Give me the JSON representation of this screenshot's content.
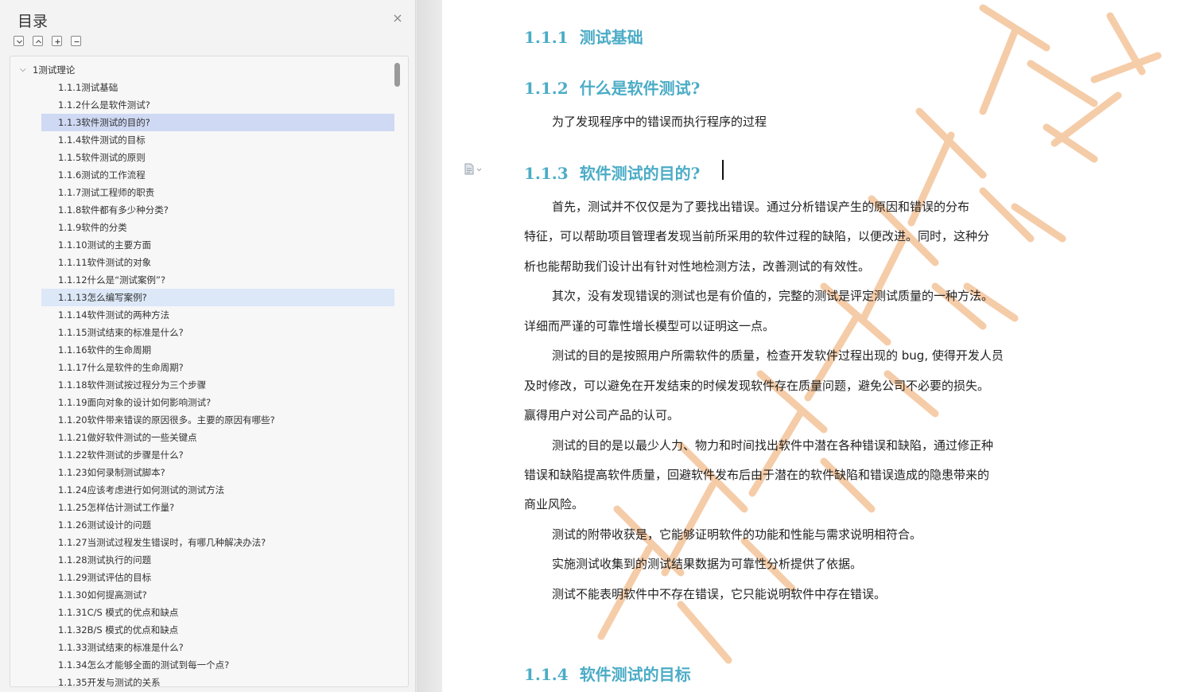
{
  "toc": {
    "title": "目录",
    "close_label": "×",
    "root": {
      "label": "1测试理论"
    },
    "items": [
      "1.1.1测试基础",
      "1.1.2什么是软件测试?",
      "1.1.3软件测试的目的?",
      "1.1.4软件测试的目标",
      "1.1.5软件测试的原则",
      "1.1.6测试的工作流程",
      "1.1.7测试工程师的职责",
      "1.1.8软件都有多少种分类?",
      "1.1.9软件的分类",
      "1.1.10测试的主要方面",
      "1.1.11软件测试的对象",
      "1.1.12什么是“测试案例”?",
      "1.1.13怎么编写案例?",
      "1.1.14软件测试的两种方法",
      "1.1.15测试结束的标准是什么?",
      "1.1.16软件的生命周期",
      "1.1.17什么是软件的生命周期?",
      "1.1.18软件测试按过程分为三个步骤",
      "1.1.19面向对象的设计如何影响测试?",
      "1.1.20软件带来错误的原因很多。主要的原因有哪些?",
      "1.1.21做好软件测试的一些关键点",
      "1.1.22软件测试的步骤是什么?",
      "1.1.23如何录制测试脚本?",
      "1.1.24应该考虑进行如何测试的测试方法",
      "1.1.25怎样估计测试工作量?",
      "1.1.26测试设计的问题",
      "1.1.27当测试过程发生错误时，有哪几种解决办法?",
      "1.1.28测试执行的问题",
      "1.1.29测试评估的目标",
      "1.1.30如何提高测试?",
      "1.1.31C/S 模式的优点和缺点",
      "1.1.32B/S 模式的优点和缺点",
      "1.1.33测试结束的标准是什么?",
      "1.1.34怎么才能够全面的测试到每一个点?",
      "1.1.35开发与测试的关系"
    ],
    "selected_index": 2,
    "hover_index": 12
  },
  "document": {
    "headings": [
      {
        "num": "1.1.1",
        "text": "测试基础"
      },
      {
        "num": "1.1.2",
        "text": "什么是软件测试?"
      },
      {
        "num": "1.1.3",
        "text": "软件测试的目的?"
      },
      {
        "num": "1.1.4",
        "text": "软件测试的目标"
      }
    ],
    "lines": [
      "为了发现程序中的错误而执行程序的过程",
      "首先，测试并不仅仅是为了要找出错误。通过分析错误产生的原因和错误的分布",
      "特征，可以帮助项目管理者发现当前所采用的软件过程的缺陷，以便改进。同时，这种分",
      "析也能帮助我们设计出有针对性地检测方法，改善测试的有效性。",
      "其次，没有发现错误的测试也是有价值的，完整的测试是评定测试质量的一种方法。",
      "详细而严谨的可靠性增长模型可以证明这一点。",
      "测试的目的是按照用户所需软件的质量，检查开发软件过程出现的 bug, 使得开发人员",
      "及时修改，可以避免在开发结束的时候发现软件存在质量问题，避免公司不必要的损失。",
      "赢得用户对公司产品的认可。",
      "测试的目的是以最少人力、物力和时间找出软件中潜在各种错误和缺陷，通过修正种",
      "错误和缺陷提高软件质量，回避软件发布后由于潜在的软件缺陷和错误造成的隐患带来的",
      "商业风险。",
      "测试的附带收获是，它能够证明软件的功能和性能与需求说明相符合。",
      "实施测试收集到的测试结果数据为可靠性分析提供了依据。",
      "测试不能表明软件中不存在错误，它只能说明软件中存在错误。"
    ]
  },
  "colors": {
    "heading": "#4bacc6",
    "selected_row": "#cfd9f4",
    "hover_row": "#dce8f8",
    "watermark": "#f4c49a"
  }
}
